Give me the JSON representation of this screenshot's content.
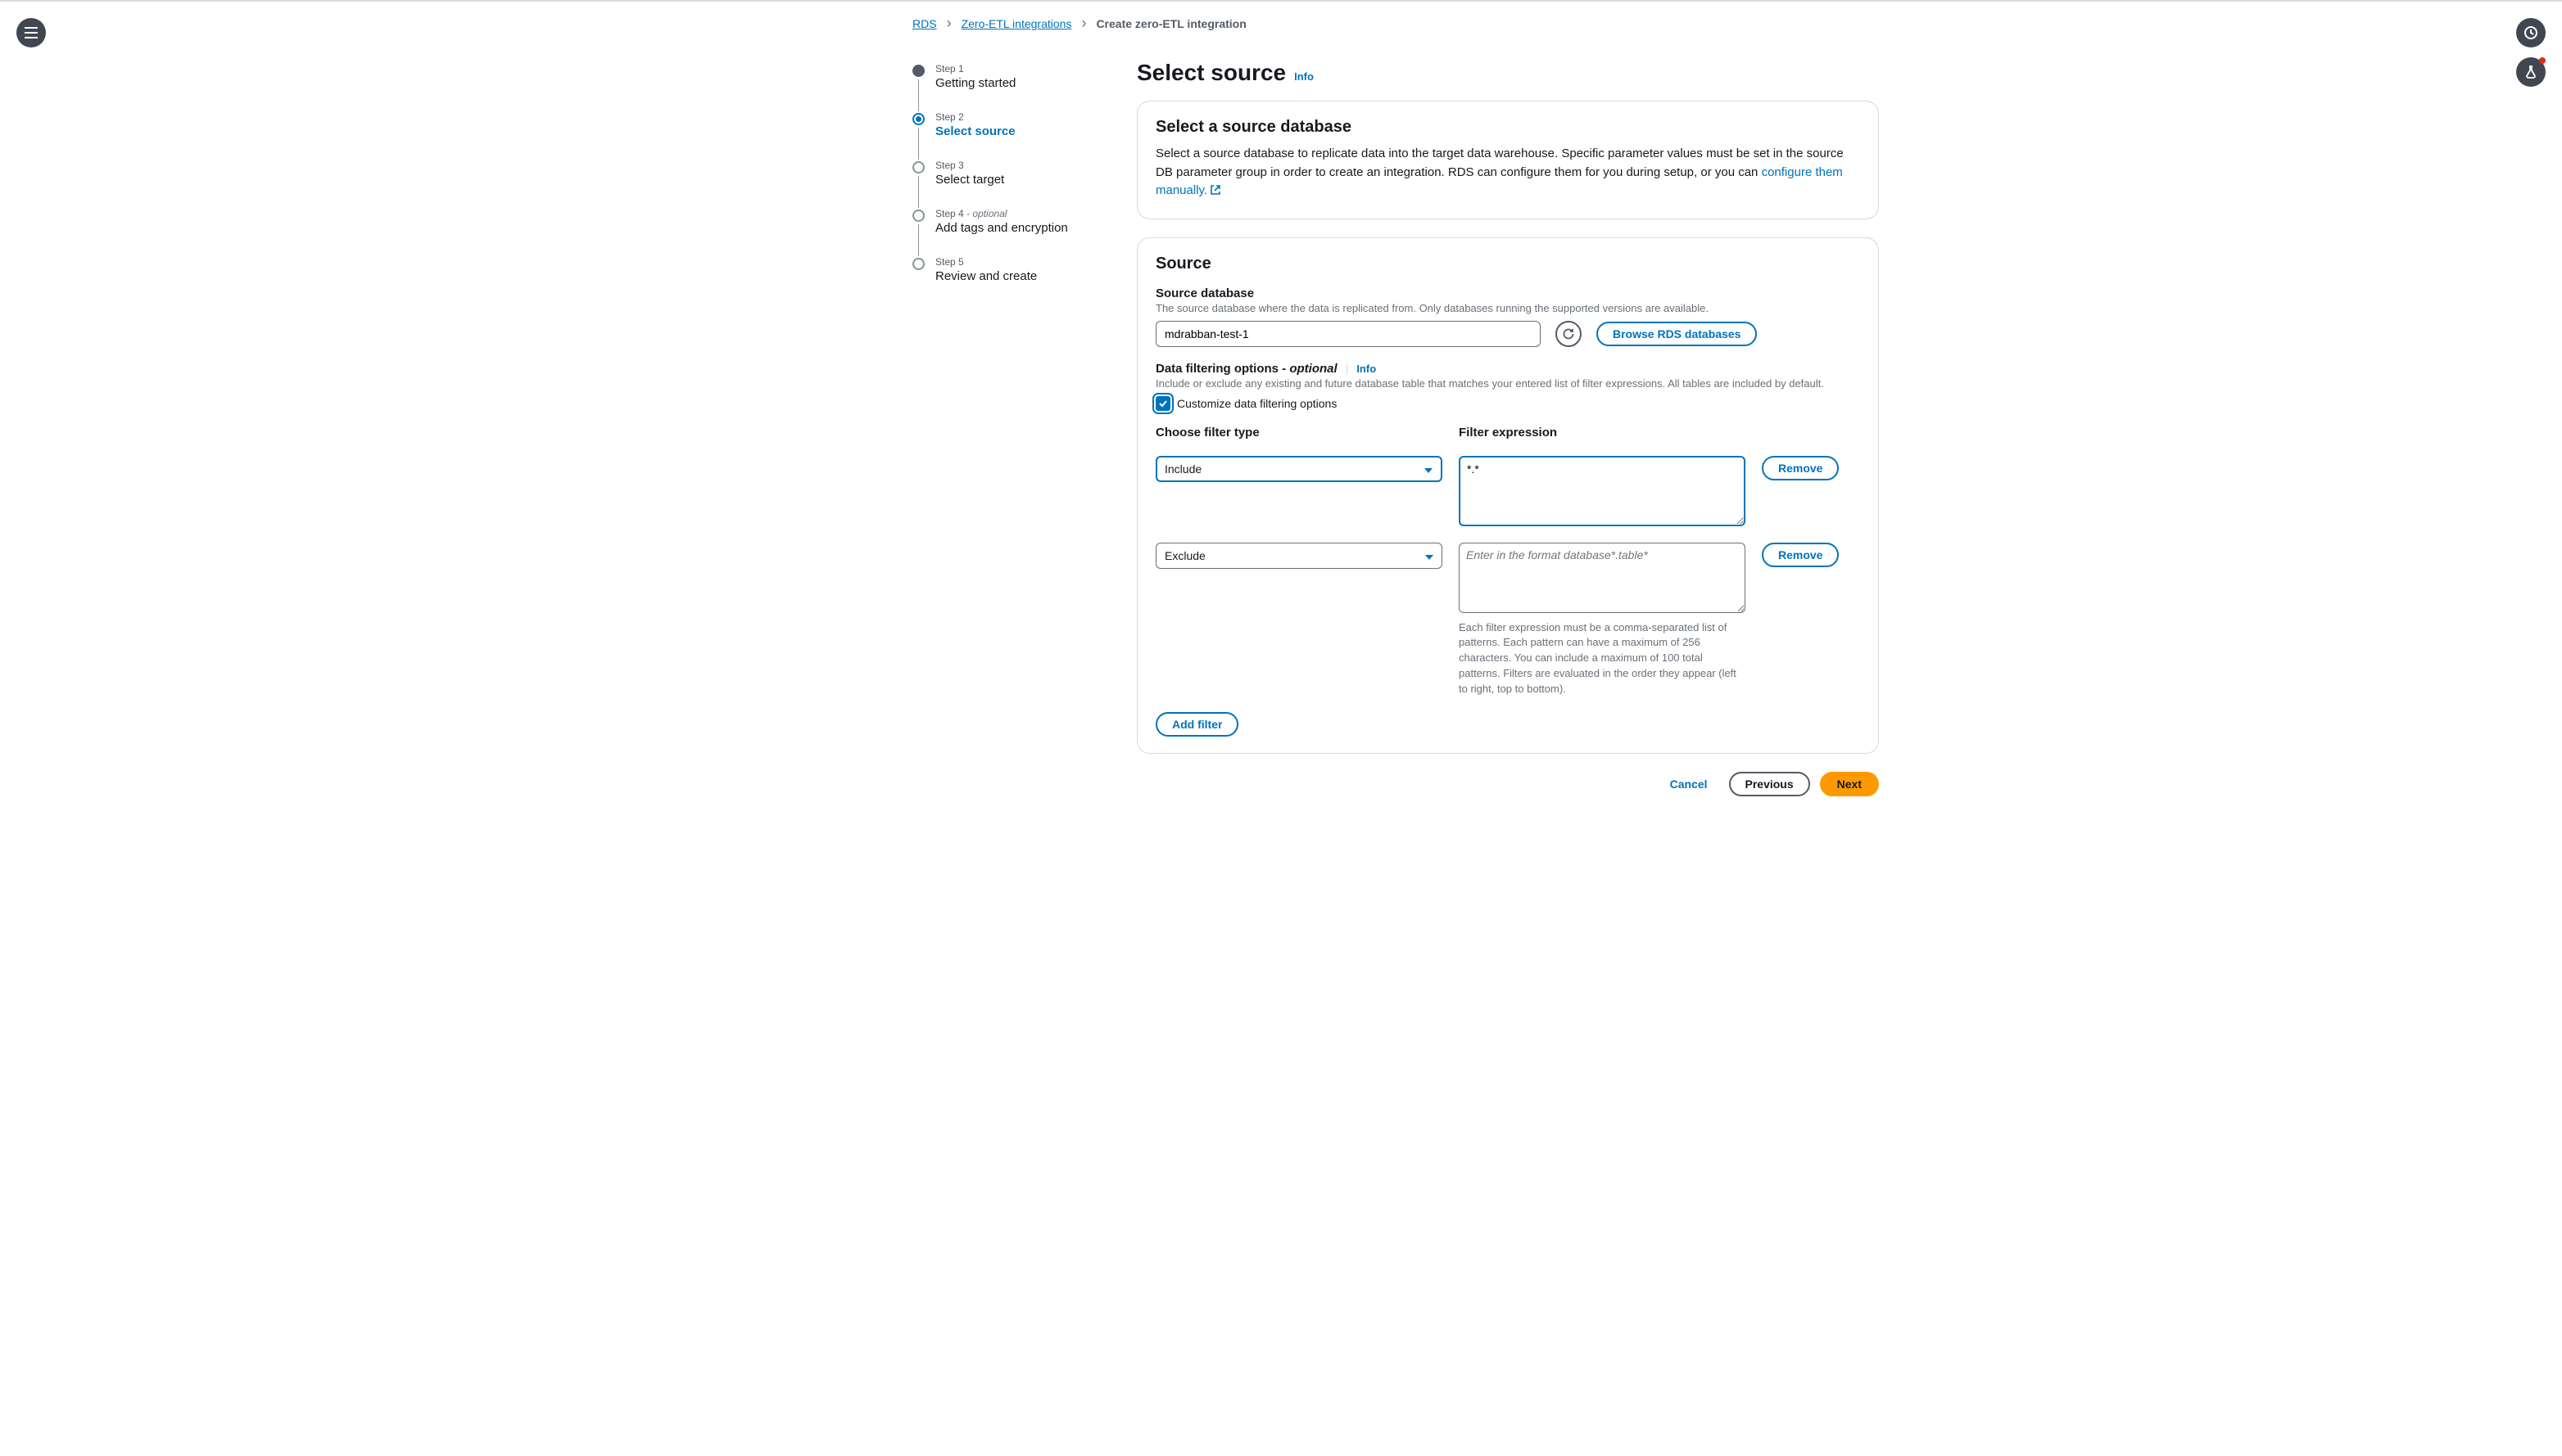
{
  "breadcrumb": {
    "items": [
      "RDS",
      "Zero-ETL integrations",
      "Create zero-ETL integration"
    ]
  },
  "steps": [
    {
      "num": "Step 1",
      "label": "Getting started",
      "state": "completed"
    },
    {
      "num": "Step 2",
      "label": "Select source",
      "state": "active"
    },
    {
      "num": "Step 3",
      "label": "Select target",
      "state": "pending"
    },
    {
      "num": "Step 4",
      "optional": " - optional",
      "label": "Add tags and encryption",
      "state": "pending"
    },
    {
      "num": "Step 5",
      "label": "Review and create",
      "state": "pending"
    }
  ],
  "page": {
    "title": "Select source",
    "info": "Info"
  },
  "panel1": {
    "title": "Select a source database",
    "desc": "Select a source database to replicate data into the target data warehouse. Specific parameter values must be set in the source DB parameter group in order to create an integration. RDS can configure them for you during setup, or you can ",
    "link": "configure them manually."
  },
  "panel2": {
    "title": "Source",
    "sourceDb": {
      "label": "Source database",
      "hint": "The source database where the data is replicated from. Only databases running the supported versions are available.",
      "value": "mdrabban-test-1",
      "browse": "Browse RDS databases"
    },
    "filterOpts": {
      "label": "Data filtering options - ",
      "optional": "optional",
      "info": "Info",
      "hint": "Include or exclude any existing and future database table that matches your entered list of filter expressions. All tables are included by default.",
      "checkboxLabel": "Customize data filtering options"
    },
    "filterCols": {
      "type": "Choose filter type",
      "expr": "Filter expression"
    },
    "filters": [
      {
        "type": "Include",
        "expr": "*.*",
        "exprPlaceholder": ""
      },
      {
        "type": "Exclude",
        "expr": "",
        "exprPlaceholder": "Enter in the format database*.table*"
      }
    ],
    "removeLabel": "Remove",
    "filterHint": "Each filter expression must be a comma-separated list of patterns. Each pattern can have a maximum of 256 characters. You can include a maximum of 100 total patterns. Filters are evaluated in the order they appear (left to right, top to bottom).",
    "addFilter": "Add filter"
  },
  "actions": {
    "cancel": "Cancel",
    "previous": "Previous",
    "next": "Next"
  }
}
